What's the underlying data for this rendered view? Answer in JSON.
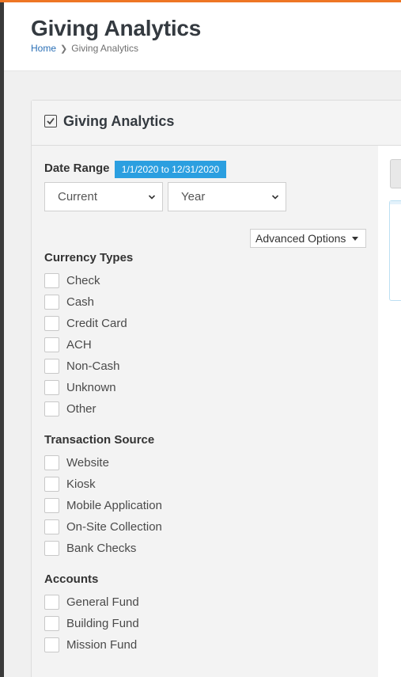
{
  "page": {
    "title": "Giving Analytics",
    "breadcrumb": {
      "home": "Home",
      "current": "Giving Analytics"
    }
  },
  "panel": {
    "title": "Giving Analytics"
  },
  "date_range": {
    "label": "Date Range",
    "badge": "1/1/2020 to 12/31/2020",
    "period_select": "Current",
    "unit_select": "Year"
  },
  "advanced_options": {
    "label": "Advanced Options"
  },
  "currency_types": {
    "label": "Currency Types",
    "items": [
      "Check",
      "Cash",
      "Credit Card",
      "ACH",
      "Non-Cash",
      "Unknown",
      "Other"
    ]
  },
  "transaction_source": {
    "label": "Transaction Source",
    "items": [
      "Website",
      "Kiosk",
      "Mobile Application",
      "On-Site Collection",
      "Bank Checks"
    ]
  },
  "accounts": {
    "label": "Accounts",
    "items": [
      "General Fund",
      "Building Fund",
      "Mission Fund"
    ]
  },
  "colors": {
    "accent": "#ee7624",
    "badge": "#2b9fe0",
    "link": "#2a6fb6"
  }
}
